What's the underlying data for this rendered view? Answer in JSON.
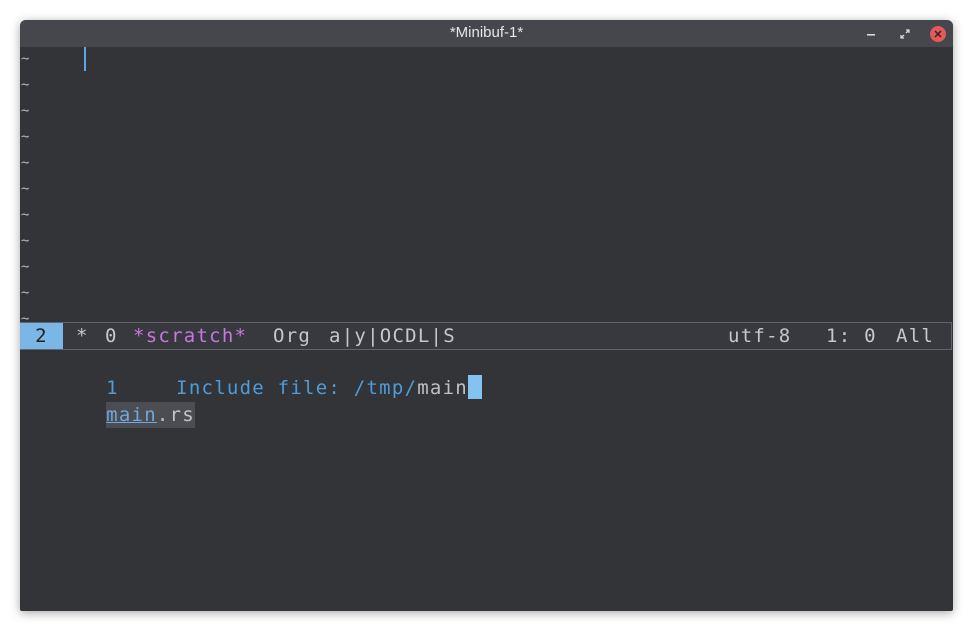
{
  "window": {
    "title": "*Minibuf-1*",
    "controls": {
      "minimize_icon": "minimize-icon",
      "maximize_icon": "restore-icon",
      "close_icon": "close-icon"
    }
  },
  "editor": {
    "empty_line_marker": "~",
    "empty_line_count": 11
  },
  "modeline": {
    "window_number": "2",
    "modified_flag": "*",
    "zero": "0",
    "buffer_name": "*scratch*",
    "major_mode": "Org",
    "minor_modes": "a|y|OCDL|S",
    "encoding": "utf-8",
    "position": "1: 0",
    "scroll": "All"
  },
  "minibuffer": {
    "count": "1",
    "prompt": "Include file: /tmp/",
    "input": "main",
    "candidates": [
      {
        "match": "main",
        "rest": ".rs"
      }
    ]
  },
  "colors": {
    "background": "#323438",
    "titlebar": "#45474c",
    "accent_blue": "#4f9bd8",
    "buffer_name_purple": "#c678dd",
    "close_button_red": "#e25a5a"
  }
}
